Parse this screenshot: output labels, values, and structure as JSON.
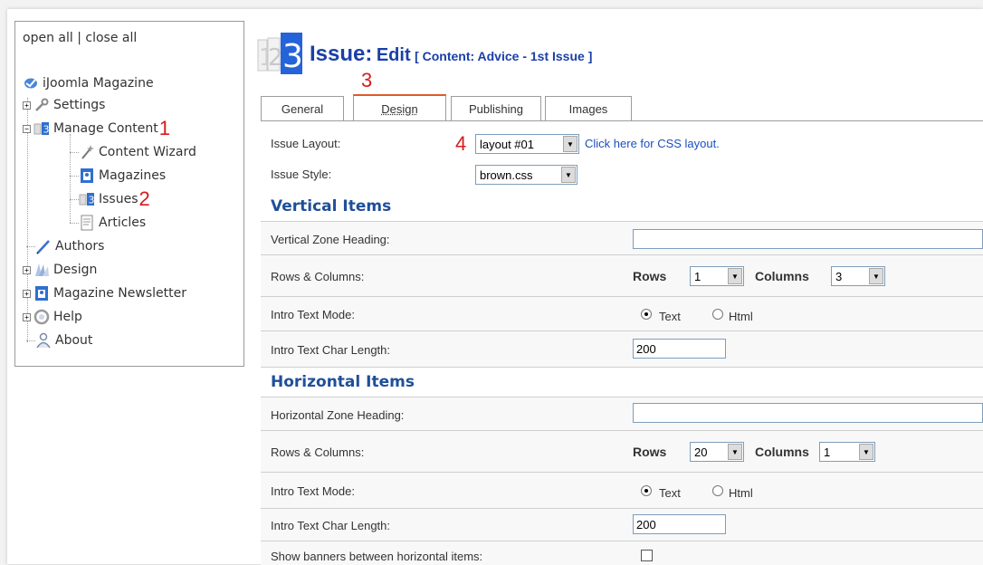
{
  "sidebar": {
    "open_all": "open all",
    "separator": "|",
    "close_all": "close all",
    "root": "iJoomla Magazine",
    "items": [
      {
        "label": "Settings",
        "icon": "wrench-icon"
      },
      {
        "label": "Manage Content",
        "icon": "issue-icon",
        "annotation": "1"
      },
      {
        "label": "Content Wizard",
        "icon": "wand-icon"
      },
      {
        "label": "Magazines",
        "icon": "magazine-icon"
      },
      {
        "label": "Issues",
        "icon": "issue-icon",
        "annotation": "2"
      },
      {
        "label": "Articles",
        "icon": "document-icon"
      },
      {
        "label": "Authors",
        "icon": "pen-icon"
      },
      {
        "label": "Design",
        "icon": "palette-icon"
      },
      {
        "label": "Magazine Newsletter",
        "icon": "magazine-icon"
      },
      {
        "label": "Help",
        "icon": "help-icon"
      },
      {
        "label": "About",
        "icon": "user-icon"
      }
    ]
  },
  "header": {
    "icon_number": "3",
    "title": "Issue:",
    "action": "Edit",
    "context": "[ Content: Advice - 1st Issue ]"
  },
  "annotations": {
    "design_tab": "3",
    "issue_layout": "4"
  },
  "tabs": [
    {
      "label": "General",
      "active": false
    },
    {
      "label": "Design",
      "active": true
    },
    {
      "label": "Publishing",
      "active": false
    },
    {
      "label": "Images",
      "active": false
    }
  ],
  "form": {
    "issue_layout_label": "Issue Layout:",
    "issue_layout_value": "layout #01",
    "css_link": "Click here for CSS layout.",
    "issue_style_label": "Issue Style:",
    "issue_style_value": "brown.css",
    "vertical": {
      "section": "Vertical Items",
      "zone_heading_label": "Vertical Zone Heading:",
      "zone_heading_value": "",
      "rows_cols_label": "Rows & Columns:",
      "rows_label": "Rows",
      "rows_value": "1",
      "columns_label": "Columns",
      "columns_value": "3",
      "intro_mode_label": "Intro Text Mode:",
      "mode_text": "Text",
      "mode_html": "Html",
      "intro_length_label": "Intro Text Char Length:",
      "intro_length_value": "200"
    },
    "horizontal": {
      "section": "Horizontal Items",
      "zone_heading_label": "Horizontal Zone Heading:",
      "zone_heading_value": "",
      "rows_cols_label": "Rows & Columns:",
      "rows_label": "Rows",
      "rows_value": "20",
      "columns_label": "Columns",
      "columns_value": "1",
      "intro_mode_label": "Intro Text Mode:",
      "mode_text": "Text",
      "mode_html": "Html",
      "intro_length_label": "Intro Text Char Length:",
      "intro_length_value": "200",
      "banners_label": "Show banners between horizontal items:"
    }
  },
  "colors": {
    "accent": "#1a3fa8",
    "section": "#1f4f99",
    "annotation": "#d61c1c",
    "active_tab": "#e05a28"
  }
}
